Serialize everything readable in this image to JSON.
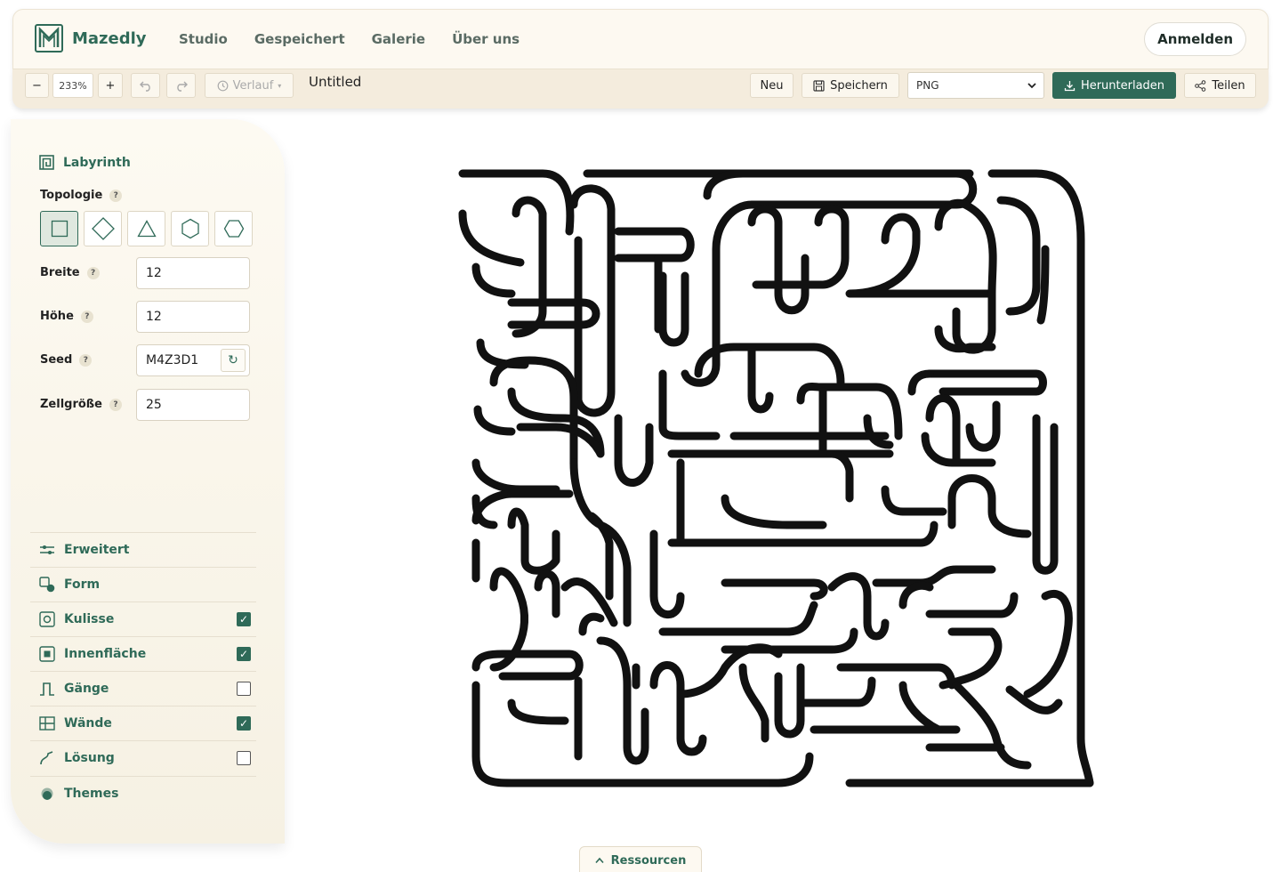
{
  "nav": {
    "brand": "Mazedly",
    "links": [
      "Studio",
      "Gespeichert",
      "Galerie",
      "Über uns"
    ],
    "login": "Anmelden"
  },
  "toolbar": {
    "zoom_minus": "−",
    "zoom_value": "233%",
    "zoom_plus": "+",
    "history_label": "Verlauf",
    "doc_title": "Untitled",
    "new_label": "Neu",
    "save_label": "Speichern",
    "format_value": "PNG",
    "download_label": "Herunterladen",
    "share_label": "Teilen"
  },
  "sidebar": {
    "section_title": "Labyrinth",
    "topology_label": "Topologie",
    "topology_options": [
      "square",
      "diamond",
      "triangle",
      "hexagon",
      "hexagon-flat"
    ],
    "topology_selected": "square",
    "fields": {
      "width_label": "Breite",
      "width_value": "12",
      "height_label": "Höhe",
      "height_value": "12",
      "seed_label": "Seed",
      "seed_value": "M4Z3D1",
      "cell_label": "Zellgröße",
      "cell_value": "25"
    },
    "help_mark": "?",
    "accordion": [
      {
        "label": "Erweitert",
        "icon": "sliders-icon",
        "checkbox": null
      },
      {
        "label": "Form",
        "icon": "shapes-icon",
        "checkbox": null
      },
      {
        "label": "Kulisse",
        "icon": "frame-icon",
        "checkbox": true
      },
      {
        "label": "Innenfläche",
        "icon": "inner-square-icon",
        "checkbox": true
      },
      {
        "label": "Gänge",
        "icon": "path-step-icon",
        "checkbox": false
      },
      {
        "label": "Wände",
        "icon": "grid-icon",
        "checkbox": true
      },
      {
        "label": "Lösung",
        "icon": "curve-icon",
        "checkbox": false
      },
      {
        "label": "Themes",
        "icon": "palette-icon",
        "checkbox": null
      }
    ]
  },
  "resources": {
    "label": "Ressourcen"
  },
  "colors": {
    "accent": "#2f6a58",
    "panel": "#fdfaf2",
    "wall": "#111111"
  }
}
